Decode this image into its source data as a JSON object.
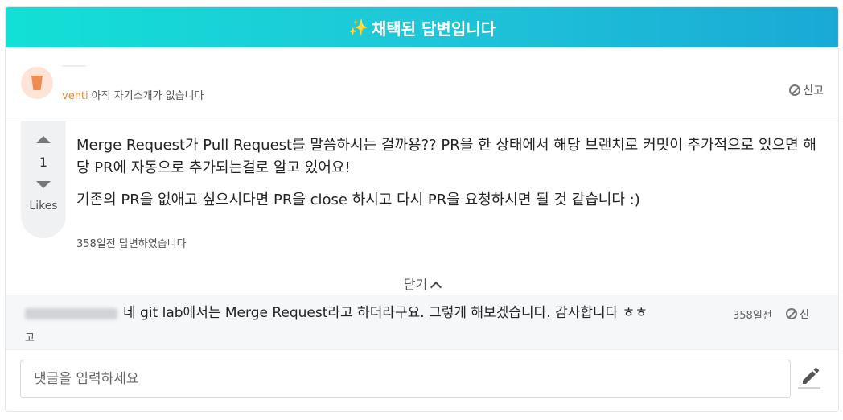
{
  "banner": {
    "icon": "sparkles-icon",
    "spark": "✨",
    "title": "채택된 답변입니다"
  },
  "author": {
    "username": "venti",
    "bio": "아직 자기소개가 없습니다",
    "report_label": "신고"
  },
  "answer": {
    "likes_count": "1",
    "likes_label": "Likes",
    "paragraphs": [
      "Merge Request가 Pull Request를 말씀하시는 걸까용?? PR을 한 상태에서 해당 브랜치로 커밋이 추가적으로 있으면 해당 PR에 자동으로 추가되는걸로 알고 있어요!",
      "기존의 PR을 없애고 싶으시다면 PR을 close 하시고 다시 PR을 요청하시면 될 것 같습니다 :)"
    ],
    "time": "358일전 답변하였습니다",
    "close_label": "닫기"
  },
  "comment": {
    "text": "네 git lab에서는 Merge Request라고 하더라구요. 그렇게 해보겠습니다. 감사합니다 ㅎㅎ",
    "time": "358일전",
    "report_label_a": "신",
    "report_label_b": "고"
  },
  "comment_input": {
    "placeholder": "댓글을 입력하세요"
  },
  "colors": {
    "banner_start": "#12e0d6",
    "banner_end": "#1aa9d6",
    "username": "#e8893f"
  }
}
